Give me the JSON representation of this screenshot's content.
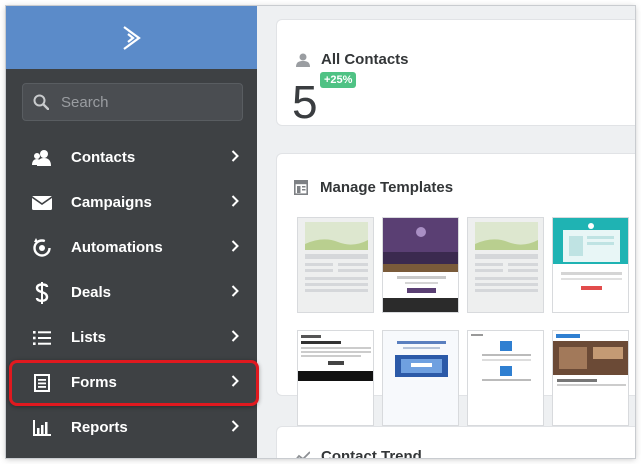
{
  "sidebar": {
    "search_placeholder": "Search",
    "items": [
      {
        "label": "Contacts",
        "icon": "contacts-icon"
      },
      {
        "label": "Campaigns",
        "icon": "envelope-icon"
      },
      {
        "label": "Automations",
        "icon": "automations-icon"
      },
      {
        "label": "Deals",
        "icon": "dollar-icon"
      },
      {
        "label": "Lists",
        "icon": "list-icon"
      },
      {
        "label": "Forms",
        "icon": "form-icon"
      },
      {
        "label": "Reports",
        "icon": "bar-chart-icon"
      }
    ],
    "highlighted_item": "Forms"
  },
  "main": {
    "all_contacts": {
      "title": "All Contacts",
      "count": "5",
      "change_badge": "+25%"
    },
    "manage_templates": {
      "title": "Manage Templates"
    },
    "contact_trend": {
      "title": "Contact Trend"
    }
  },
  "colors": {
    "brand": "#5b8bc9",
    "sidebar": "#3e4144",
    "badge": "#4fc284",
    "highlight": "#e0191f"
  }
}
